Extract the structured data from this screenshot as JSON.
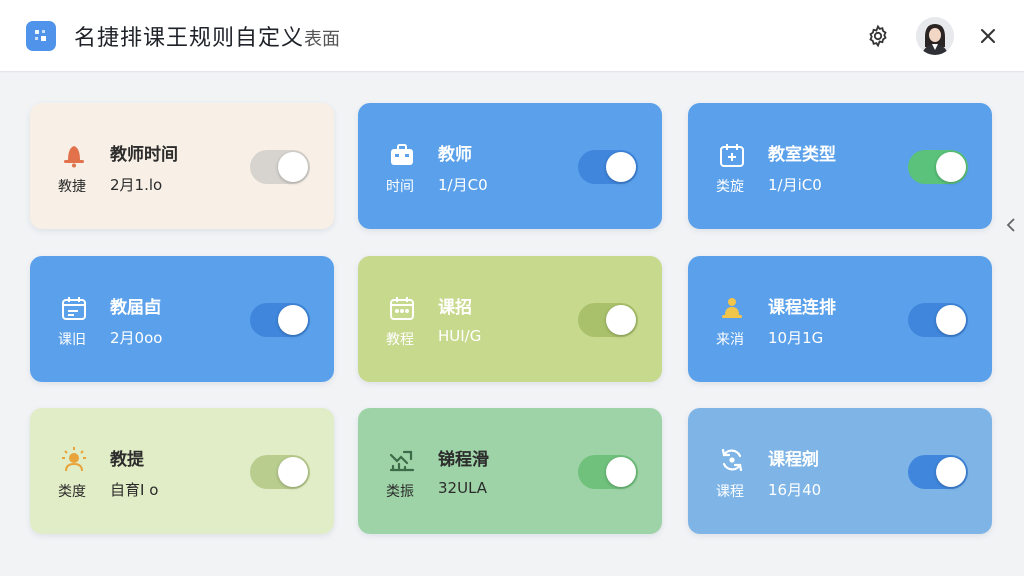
{
  "header": {
    "title": "名捷排课王规则自定义",
    "title_suffix": "表面",
    "settings_icon": "gear-icon",
    "avatar_icon": "user-avatar",
    "close_icon": "close-icon"
  },
  "colors": {
    "accent_orange": "#f2a83b",
    "brand_blue": "#4f94ea"
  },
  "cards": [
    {
      "title": "教师时间",
      "sub_label": "教捷",
      "sub_value": "2月1.lo",
      "icon": "teacher-bell-icon",
      "enabled": true
    },
    {
      "title": "教师",
      "sub_label": "时间",
      "sub_value": "1/月C0",
      "icon": "briefcase-icon",
      "enabled": true
    },
    {
      "title": "教室类型",
      "sub_label": "类旋",
      "sub_value": "1/月iC0",
      "icon": "calendar-plus-icon",
      "enabled": true
    },
    {
      "title": "教届卣",
      "sub_label": "课旧",
      "sub_value": "2月0oo",
      "icon": "calendar-icon",
      "enabled": true
    },
    {
      "title": "课招",
      "sub_label": "教程",
      "sub_value": "HUI/G",
      "icon": "calendar-dots-icon",
      "enabled": true
    },
    {
      "title": "课程连排",
      "sub_label": "来消",
      "sub_value": "10月1G",
      "icon": "person-pin-icon",
      "enabled": true
    },
    {
      "title": "教提",
      "sub_label": "类度",
      "sub_value": "自育I o",
      "icon": "sun-person-icon",
      "enabled": true
    },
    {
      "title": "锑程滑",
      "sub_label": "类振",
      "sub_value": "32ULA",
      "icon": "chart-check-icon",
      "enabled": true
    },
    {
      "title": "课程剜",
      "sub_label": "课程",
      "sub_value": "16月40",
      "icon": "refresh-icon",
      "enabled": true
    }
  ]
}
